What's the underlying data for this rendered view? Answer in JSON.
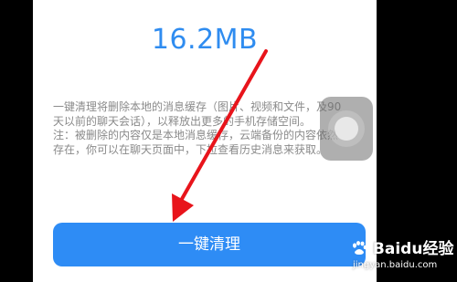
{
  "cleanup": {
    "size_value": "16.2MB",
    "description": "一键清理将删除本地的消息缓存（图片、视频和文件，及90天以前的聊天会话），以释放出更多的手机存储空间。",
    "note": "注：被删除的内容仅是本地消息缓存，云端备份的内容依然存在，你可以在聊天页面中，下拉查看历史消息来获取。",
    "button_label": "一键清理"
  },
  "watermark": {
    "brand": "Baidu经验",
    "url": "jingyan.baidu.com"
  },
  "colors": {
    "accent": "#2e8cf5",
    "size_text": "#2f8cf0",
    "annotation_arrow": "#e8141b"
  },
  "icons": {
    "assistive_touch": "assistive-touch-icon",
    "annotation": "red-arrow-icon",
    "watermark_logo": "baidu-paw-icon"
  }
}
